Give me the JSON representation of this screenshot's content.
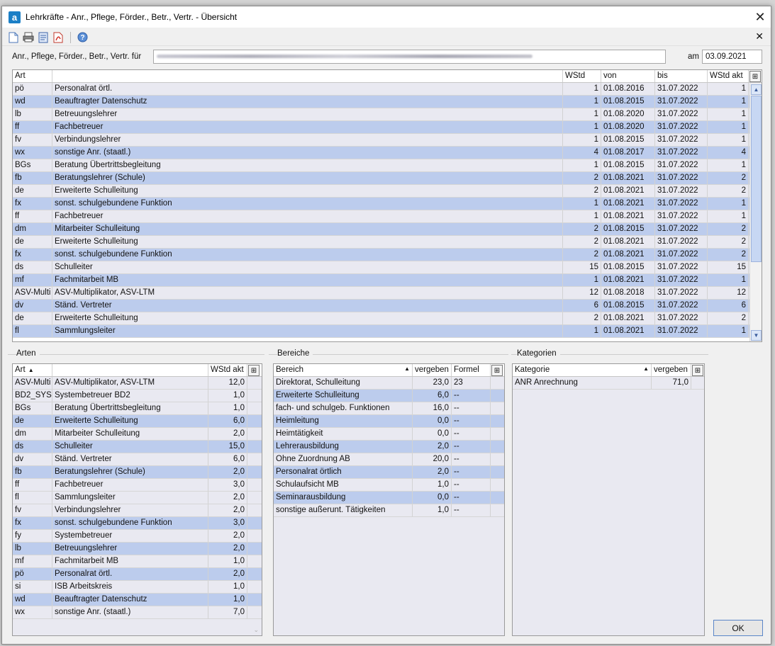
{
  "window": {
    "icon_letter": "a",
    "title": "Lehrkräfte - Anr., Pflege, Förder., Betr., Vertr. - Übersicht",
    "close_glyph": "✕"
  },
  "toolbar": {
    "icons": [
      "new-document-icon",
      "print-icon",
      "print-preview-icon",
      "pdf-icon",
      "help-icon"
    ],
    "close_glyph": "✕"
  },
  "params": {
    "label": "Anr., Pflege, Förder., Betr., Vertr. für",
    "date_label": "am",
    "date_value": "03.09.2021"
  },
  "main_table": {
    "headers": [
      "Art",
      "",
      "WStd",
      "von",
      "bis",
      "WStd akt"
    ],
    "rows": [
      [
        "pö",
        "Personalrat örtl.",
        "1",
        "01.08.2016",
        "31.07.2022",
        "1"
      ],
      [
        "wd",
        "Beauftragter Datenschutz",
        "1",
        "01.08.2015",
        "31.07.2022",
        "1"
      ],
      [
        "lb",
        "Betreuungslehrer",
        "1",
        "01.08.2020",
        "31.07.2022",
        "1"
      ],
      [
        "ff",
        "Fachbetreuer",
        "1",
        "01.08.2020",
        "31.07.2022",
        "1"
      ],
      [
        "fv",
        "Verbindungslehrer",
        "1",
        "01.08.2015",
        "31.07.2022",
        "1"
      ],
      [
        "wx",
        "sonstige Anr. (staatl.)",
        "4",
        "01.08.2017",
        "31.07.2022",
        "4"
      ],
      [
        "BGs",
        "Beratung Übertrittsbegleitung",
        "1",
        "01.08.2015",
        "31.07.2022",
        "1"
      ],
      [
        "fb",
        "Beratungslehrer (Schule)",
        "2",
        "01.08.2021",
        "31.07.2022",
        "2"
      ],
      [
        "de",
        "Erweiterte Schulleitung",
        "2",
        "01.08.2021",
        "31.07.2022",
        "2"
      ],
      [
        "fx",
        "sonst. schulgebundene Funktion",
        "1",
        "01.08.2021",
        "31.07.2022",
        "1"
      ],
      [
        "ff",
        "Fachbetreuer",
        "1",
        "01.08.2021",
        "31.07.2022",
        "1"
      ],
      [
        "dm",
        "Mitarbeiter Schulleitung",
        "2",
        "01.08.2015",
        "31.07.2022",
        "2"
      ],
      [
        "de",
        "Erweiterte Schulleitung",
        "2",
        "01.08.2021",
        "31.07.2022",
        "2"
      ],
      [
        "fx",
        "sonst. schulgebundene Funktion",
        "2",
        "01.08.2021",
        "31.07.2022",
        "2"
      ],
      [
        "ds",
        "Schulleiter",
        "15",
        "01.08.2015",
        "31.07.2022",
        "15"
      ],
      [
        "mf",
        "Fachmitarbeit MB",
        "1",
        "01.08.2021",
        "31.07.2022",
        "1"
      ],
      [
        "ASV-Multi",
        "ASV-Multiplikator, ASV-LTM",
        "12",
        "01.08.2018",
        "31.07.2022",
        "12"
      ],
      [
        "dv",
        "Ständ. Vertreter",
        "6",
        "01.08.2015",
        "31.07.2022",
        "6"
      ],
      [
        "de",
        "Erweiterte Schulleitung",
        "2",
        "01.08.2021",
        "31.07.2022",
        "2"
      ],
      [
        "fl",
        "Sammlungsleiter",
        "1",
        "01.08.2021",
        "31.07.2022",
        "1"
      ]
    ]
  },
  "arten": {
    "title": "Arten",
    "headers": [
      "Art",
      "",
      "WStd akt"
    ],
    "rows": [
      [
        "ASV-Multi",
        "ASV-Multiplikator, ASV-LTM",
        "12,0"
      ],
      [
        "BD2_SYS",
        "Systembetreuer BD2",
        "1,0"
      ],
      [
        "BGs",
        "Beratung Übertrittsbegleitung",
        "1,0"
      ],
      [
        "de",
        "Erweiterte Schulleitung",
        "6,0"
      ],
      [
        "dm",
        "Mitarbeiter Schulleitung",
        "2,0"
      ],
      [
        "ds",
        "Schulleiter",
        "15,0"
      ],
      [
        "dv",
        "Ständ. Vertreter",
        "6,0"
      ],
      [
        "fb",
        "Beratungslehrer (Schule)",
        "2,0"
      ],
      [
        "ff",
        "Fachbetreuer",
        "3,0"
      ],
      [
        "fl",
        "Sammlungsleiter",
        "2,0"
      ],
      [
        "fv",
        "Verbindungslehrer",
        "2,0"
      ],
      [
        "fx",
        "sonst. schulgebundene Funktion",
        "3,0"
      ],
      [
        "fy",
        "Systembetreuer",
        "2,0"
      ],
      [
        "lb",
        "Betreuungslehrer",
        "2,0"
      ],
      [
        "mf",
        "Fachmitarbeit MB",
        "1,0"
      ],
      [
        "pö",
        "Personalrat örtl.",
        "2,0"
      ],
      [
        "si",
        "ISB Arbeitskreis",
        "1,0"
      ],
      [
        "wd",
        "Beauftragter Datenschutz",
        "1,0"
      ],
      [
        "wx",
        "sonstige Anr. (staatl.)",
        "7,0"
      ]
    ]
  },
  "bereiche": {
    "title": "Bereiche",
    "headers": [
      "Bereich",
      "vergeben",
      "Formel"
    ],
    "rows": [
      [
        "Direktorat, Schulleitung",
        "23,0",
        "23"
      ],
      [
        "Erweiterte Schulleitung",
        "6,0",
        "--"
      ],
      [
        "fach- und schulgeb. Funktionen",
        "16,0",
        "--"
      ],
      [
        "Heimleitung",
        "0,0",
        "--"
      ],
      [
        "Heimtätigkeit",
        "0,0",
        "--"
      ],
      [
        "Lehrerausbildung",
        "2,0",
        "--"
      ],
      [
        "Ohne Zuordnung AB",
        "20,0",
        "--"
      ],
      [
        "Personalrat örtlich",
        "2,0",
        "--"
      ],
      [
        "Schulaufsicht MB",
        "1,0",
        "--"
      ],
      [
        "Seminarausbildung",
        "0,0",
        "--"
      ],
      [
        "sonstige außerunt. Tätigkeiten",
        "1,0",
        "--"
      ]
    ]
  },
  "kategorien": {
    "title": "Kategorien",
    "headers": [
      "Kategorie",
      "vergeben"
    ],
    "rows": [
      [
        "ANR Anrechnung",
        "71,0"
      ]
    ]
  },
  "ok_label": "OK"
}
